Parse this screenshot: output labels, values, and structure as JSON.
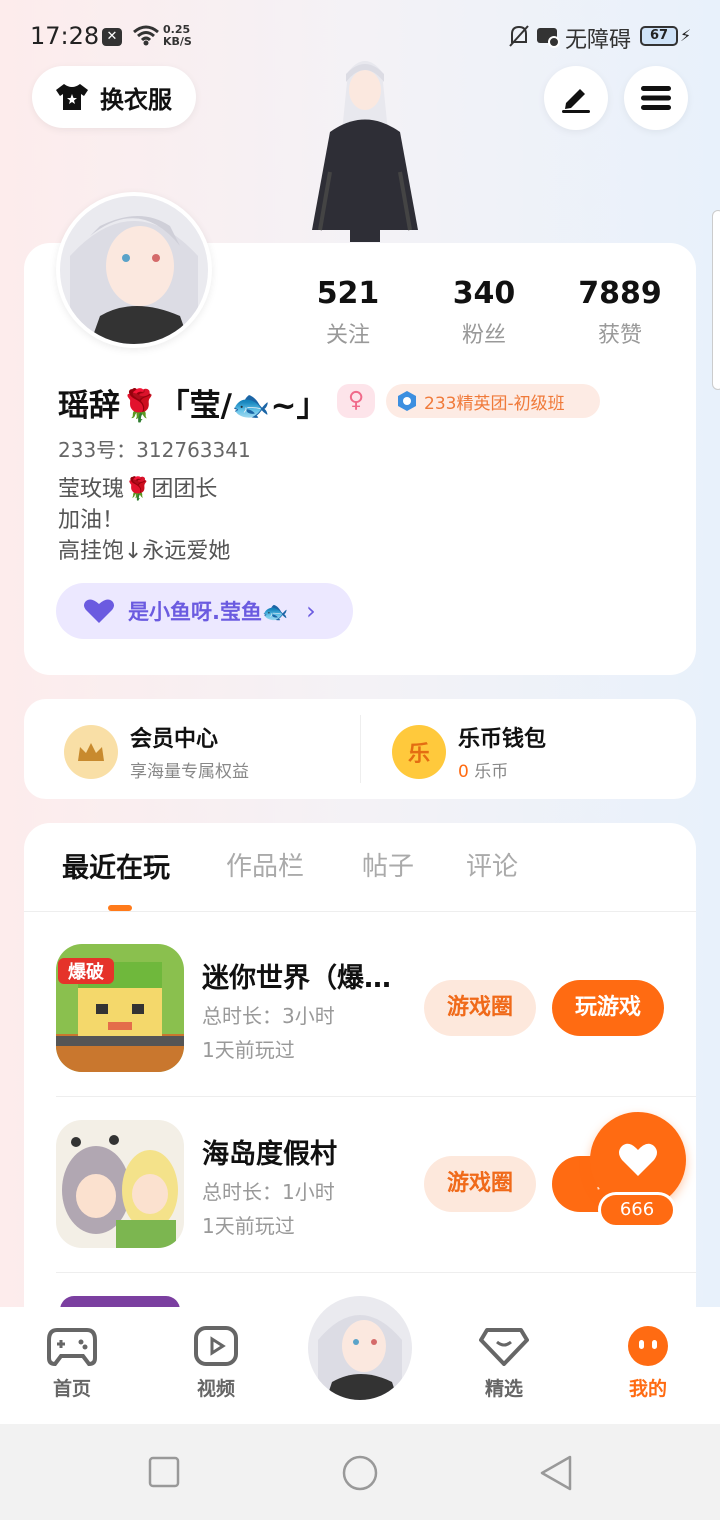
{
  "status_bar": {
    "time": "17:28",
    "net_speed_value": "0.25",
    "net_speed_unit": "KB/S",
    "accessibility": "无障碍",
    "battery": "67"
  },
  "header": {
    "wardrobe_label": "换衣服"
  },
  "profile": {
    "stats": [
      {
        "num": "521",
        "label": "关注"
      },
      {
        "num": "340",
        "label": "粉丝"
      },
      {
        "num": "7889",
        "label": "获赞"
      }
    ],
    "username": "瑶辞🌹「莹/🐟~」",
    "team_badge": "233精英团-初级班",
    "uid": "233号：312763341",
    "bio_lines": [
      "莹玫瑰🌹团团长",
      "加油！",
      "高挂饱↓永远爱她"
    ],
    "fan_pill": "是小鱼呀.莹鱼🐟"
  },
  "vip": {
    "member_title": "会员中心",
    "member_sub": "享海量专属权益",
    "wallet_title": "乐币钱包",
    "wallet_amount": "0",
    "wallet_unit": "乐币"
  },
  "tabs": [
    "最近在玩",
    "作品栏",
    "帖子",
    "评论"
  ],
  "games": [
    {
      "name": "迷你世界（爆…",
      "duration": "总时长：3小时",
      "last_played": "1天前玩过",
      "icon_text": "爆破"
    },
    {
      "name": "海岛度假村",
      "duration": "总时长：1小时",
      "last_played": "1天前玩过"
    }
  ],
  "buttons": {
    "circle": "游戏圈",
    "play": "玩游戏",
    "play_partial": "玩"
  },
  "heart": {
    "count": "666"
  },
  "nav": [
    {
      "label": "首页"
    },
    {
      "label": "视频"
    },
    {
      "label": "精选"
    },
    {
      "label": "我的"
    }
  ],
  "colors": {
    "accent": "#ff6b12",
    "fan_pill": "#6b5be0",
    "team_badge": "#f07a3a"
  }
}
